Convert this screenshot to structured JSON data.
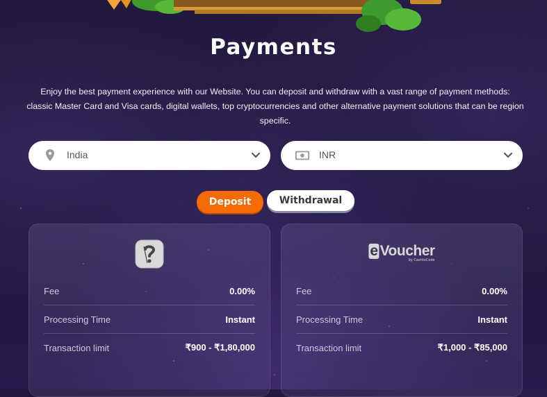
{
  "page": {
    "title": "Payments",
    "description": "Enjoy the best payment experience with our Website. You can deposit and withdraw with a vast range of payment methods: classic Master Card and Visa cards, digital wallets, top cryptocurrencies and other alternative payment solutions that can be region specific."
  },
  "filters": {
    "country": {
      "value": "India",
      "icon": "location-pin-icon"
    },
    "currency": {
      "value": "INR",
      "icon": "banknote-icon"
    }
  },
  "tabs": {
    "deposit": "Deposit",
    "withdrawal": "Withdrawal",
    "active": "deposit"
  },
  "methods": [
    {
      "logo": "unknown-method-icon",
      "rows": [
        {
          "label": "Fee",
          "value": "0.00%"
        },
        {
          "label": "Processing Time",
          "value": "Instant"
        },
        {
          "label": "Transaction limit",
          "value": "₹900 - ₹1,80,000"
        }
      ]
    },
    {
      "logo": "evoucher-logo",
      "logo_text": "eVoucher",
      "logo_sub": "by CashtoCode",
      "rows": [
        {
          "label": "Fee",
          "value": "0.00%"
        },
        {
          "label": "Processing Time",
          "value": "Instant"
        },
        {
          "label": "Transaction limit",
          "value": "₹1,000 - ₹85,000"
        }
      ]
    }
  ],
  "colors": {
    "accent": "#f46a06",
    "background": "#221840"
  }
}
